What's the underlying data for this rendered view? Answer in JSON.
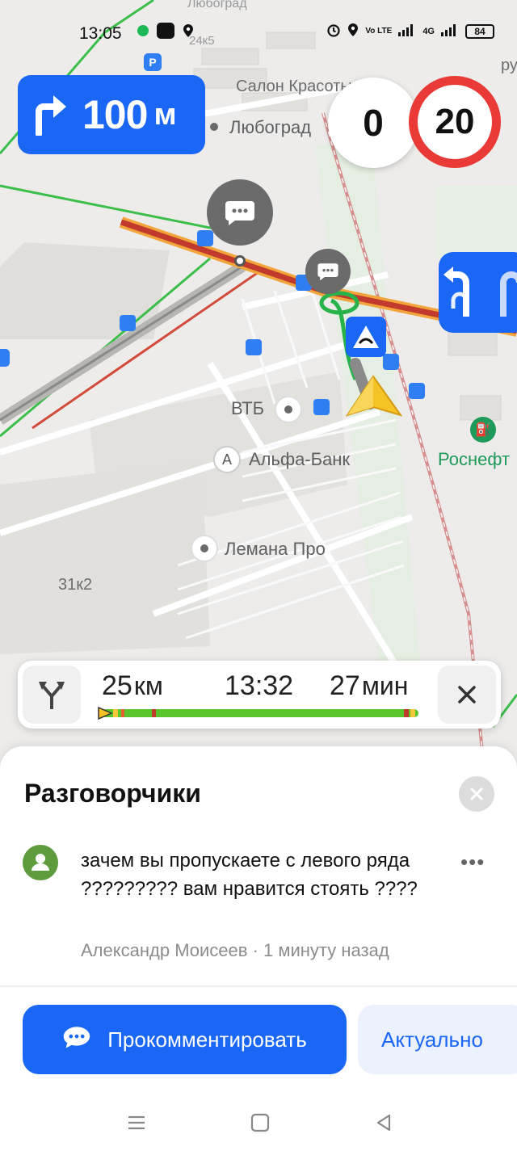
{
  "status_bar": {
    "time": "13:05",
    "network_label": "Vo LTE",
    "network_type": "4G",
    "battery": "84"
  },
  "maneuver": {
    "icon": "turn-right-arrow-icon",
    "distance": "100",
    "unit": "м"
  },
  "speed": {
    "current": "0",
    "limit": "20",
    "limit_color": "#e93a37"
  },
  "map": {
    "labels": {
      "top": "Любоград",
      "salon": "Салон Красоты",
      "lyubograd": "Любоград",
      "building_top": "24к5",
      "vtb": "ВТБ",
      "alfa": "Альфа-Банк",
      "lemana": "Лемана Про",
      "rosneft": "Роснефт",
      "building": "31к2",
      "stream": "руч"
    }
  },
  "route": {
    "distance": "25",
    "distance_unit": "км",
    "arrival": "13:32",
    "duration": "27",
    "duration_unit": "мин",
    "traffic_color": "#5ac42b"
  },
  "sheet": {
    "title": "Разговорчики",
    "comment_text": "зачем вы пропускаете с левого ряда ????????? вам нравится стоять ????",
    "author": "Александр Моисеев",
    "separator": " · ",
    "time_ago": "1 минуту назад",
    "more": "•••",
    "comment_button": "Прокомментировать",
    "actual_button": "Актуально"
  },
  "colors": {
    "accent": "#1a66f5",
    "route_red": "#c0392b"
  }
}
